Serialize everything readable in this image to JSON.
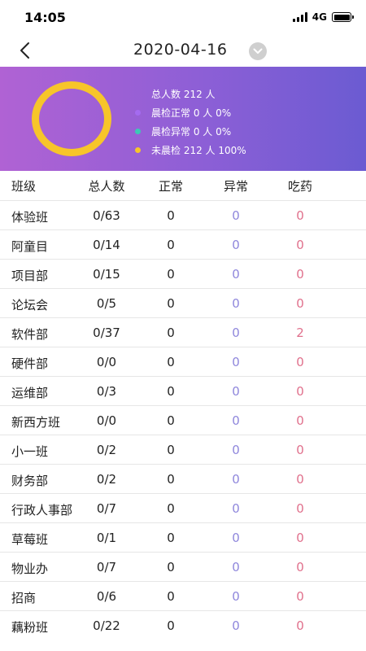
{
  "status_bar": {
    "time": "14:05",
    "network": "4G"
  },
  "header": {
    "title": "2020-04-16"
  },
  "summary": {
    "total_label": "总人数 212 人",
    "legend": [
      {
        "text": "晨检正常 0 人 0%",
        "color": "#a46bf0"
      },
      {
        "text": "晨检异常 0 人 0%",
        "color": "#3cc9b5"
      },
      {
        "text": "未晨检 212 人 100%",
        "color": "#f7c52a"
      }
    ]
  },
  "colors": {
    "banner_start": "#b062d4",
    "banner_end": "#6b5bd2",
    "ring": "#f7c52a",
    "abnormal": "#8f87dc",
    "medicine": "#e0708c"
  },
  "table": {
    "headers": {
      "name": "班级",
      "total": "总人数",
      "normal": "正常",
      "abnormal": "异常",
      "medicine": "吃药"
    },
    "rows": [
      {
        "name": "体验班",
        "total": "0/63",
        "normal": "0",
        "abnormal": "0",
        "medicine": "0"
      },
      {
        "name": "阿童目",
        "total": "0/14",
        "normal": "0",
        "abnormal": "0",
        "medicine": "0"
      },
      {
        "name": "项目部",
        "total": "0/15",
        "normal": "0",
        "abnormal": "0",
        "medicine": "0"
      },
      {
        "name": "论坛会",
        "total": "0/5",
        "normal": "0",
        "abnormal": "0",
        "medicine": "0"
      },
      {
        "name": "软件部",
        "total": "0/37",
        "normal": "0",
        "abnormal": "0",
        "medicine": "2"
      },
      {
        "name": "硬件部",
        "total": "0/0",
        "normal": "0",
        "abnormal": "0",
        "medicine": "0"
      },
      {
        "name": "运维部",
        "total": "0/3",
        "normal": "0",
        "abnormal": "0",
        "medicine": "0"
      },
      {
        "name": "新西方班",
        "total": "0/0",
        "normal": "0",
        "abnormal": "0",
        "medicine": "0"
      },
      {
        "name": "小一班",
        "total": "0/2",
        "normal": "0",
        "abnormal": "0",
        "medicine": "0"
      },
      {
        "name": "财务部",
        "total": "0/2",
        "normal": "0",
        "abnormal": "0",
        "medicine": "0"
      },
      {
        "name": "行政人事部",
        "total": "0/7",
        "normal": "0",
        "abnormal": "0",
        "medicine": "0"
      },
      {
        "name": "草莓班",
        "total": "0/1",
        "normal": "0",
        "abnormal": "0",
        "medicine": "0"
      },
      {
        "name": "物业办",
        "total": "0/7",
        "normal": "0",
        "abnormal": "0",
        "medicine": "0"
      },
      {
        "name": "招商",
        "total": "0/6",
        "normal": "0",
        "abnormal": "0",
        "medicine": "0"
      },
      {
        "name": "藕粉班",
        "total": "0/22",
        "normal": "0",
        "abnormal": "0",
        "medicine": "0"
      }
    ]
  }
}
